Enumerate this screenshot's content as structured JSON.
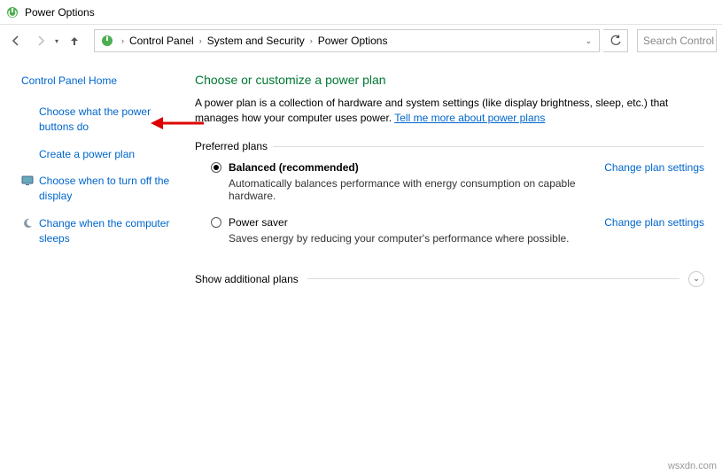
{
  "window": {
    "title": "Power Options"
  },
  "breadcrumb": {
    "items": [
      "Control Panel",
      "System and Security",
      "Power Options"
    ]
  },
  "search": {
    "placeholder": "Search Control"
  },
  "sidebar": {
    "home": "Control Panel Home",
    "items": [
      {
        "label": "Choose what the power buttons do"
      },
      {
        "label": "Create a power plan"
      },
      {
        "label": "Choose when to turn off the display"
      },
      {
        "label": "Change when the computer sleeps"
      }
    ]
  },
  "main": {
    "heading": "Choose or customize a power plan",
    "description": "A power plan is a collection of hardware and system settings (like display brightness, sleep, etc.) that manages how your computer uses power. ",
    "description_link": "Tell me more about power plans",
    "preferred_label": "Preferred plans",
    "plans": [
      {
        "name": "Balanced (recommended)",
        "desc": "Automatically balances performance with energy consumption on capable hardware.",
        "link": "Change plan settings",
        "checked": true
      },
      {
        "name": "Power saver",
        "desc": "Saves energy by reducing your computer's performance where possible.",
        "link": "Change plan settings",
        "checked": false
      }
    ],
    "show_more": "Show additional plans"
  },
  "watermark": "wsxdn.com"
}
